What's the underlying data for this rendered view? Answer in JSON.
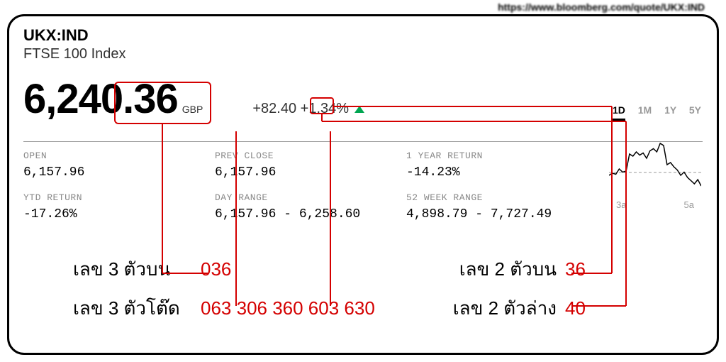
{
  "source_url": "https://www.bloomberg.com/quote/UKX:IND",
  "ticker": "UKX:IND",
  "index_name": "FTSE 100 Index",
  "price": "6,240.36",
  "currency": "GBP",
  "change_abs_prefix": "+82",
  "change_abs_40": "40",
  "change_pct": "+1.34%",
  "stats": {
    "open": {
      "label": "OPEN",
      "value": "6,157.96"
    },
    "prev_close": {
      "label": "PREV CLOSE",
      "value": "6,157.96"
    },
    "one_year_return": {
      "label": "1 YEAR RETURN",
      "value": "-14.23%"
    },
    "ytd_return": {
      "label": "YTD RETURN",
      "value": "-17.26%"
    },
    "day_range": {
      "label": "DAY RANGE",
      "value": "6,157.96 - 6,258.60"
    },
    "week52_range": {
      "label": "52 WEEK RANGE",
      "value": "4,898.79 - 7,727.49"
    }
  },
  "tabs": {
    "d1": "1D",
    "m1": "1M",
    "y1": "1Y",
    "y5": "5Y"
  },
  "mini_chart_times": {
    "a": "3a",
    "b": "5a"
  },
  "lotto": {
    "top3_label": "เลข 3 ตัวบน",
    "top3_value": "036",
    "todo3_label": "เลข 3 ตัวโต๊ด",
    "todo3_value": "063 306 360 603 630",
    "top2_label": "เลข 2 ตัวบน",
    "top2_value": "36",
    "bottom2_label": "เลข 2 ตัวล่าง",
    "bottom2_value": "40"
  },
  "chart_data": {
    "type": "line",
    "x_ticks": [
      "3a",
      "5a"
    ],
    "series": [
      {
        "name": "intraday",
        "values": [
          60,
          62,
          61,
          66,
          63,
          64,
          80,
          78,
          82,
          79,
          81,
          76,
          83,
          85,
          82,
          90,
          88,
          70,
          72,
          68,
          65,
          60,
          63,
          58,
          55,
          52,
          56,
          50
        ]
      }
    ],
    "reference": 64,
    "title": "",
    "xlabel": "",
    "ylabel": "",
    "ylim": [
      40,
      100
    ]
  }
}
